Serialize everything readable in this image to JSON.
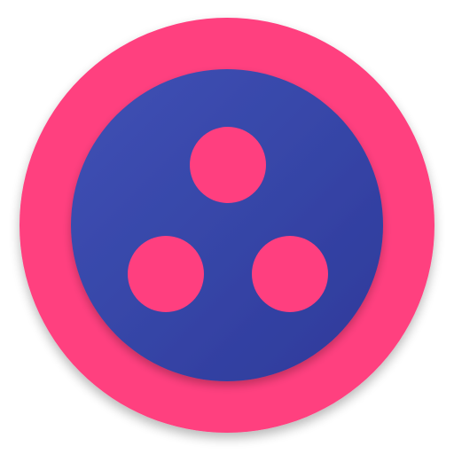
{
  "icon": {
    "name": "three-dots-circle-app-icon",
    "colors": {
      "outer_ring": "#ff3f7f",
      "inner_disc_light": "#3f51b5",
      "inner_disc_dark": "#2e3a9a",
      "dots": "#ff3f7f",
      "background": "#ffffff"
    }
  }
}
